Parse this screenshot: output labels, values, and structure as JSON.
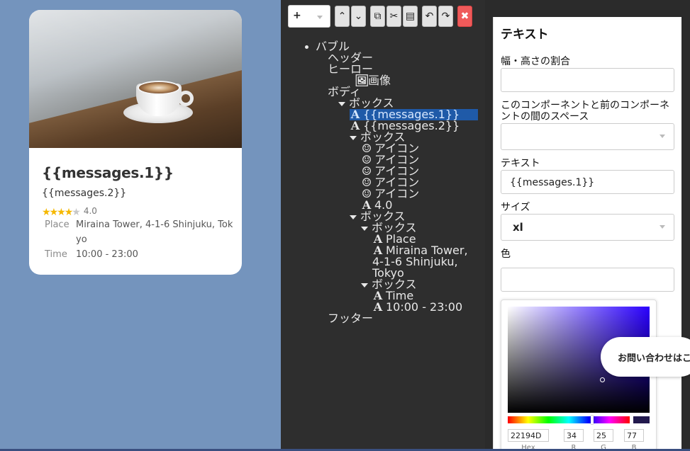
{
  "preview": {
    "title": "{{messages.1}}",
    "subtitle": "{{messages.2}}",
    "rating": {
      "value": 4,
      "max": 5,
      "label": "4.0"
    },
    "rows": [
      {
        "label": "Place",
        "value": "Miraina Tower, 4-1-6 Shinjuku, Tokyo"
      },
      {
        "label": "Time",
        "value": "10:00 - 23:00"
      }
    ]
  },
  "toolbar": {
    "add_label": "+",
    "up_icon": "chevron-up-icon",
    "down_icon": "chevron-down-icon",
    "copy_icon": "copy-icon",
    "cut_icon": "scissors-icon",
    "paste_icon": "paste-icon",
    "undo_icon": "undo-icon",
    "redo_icon": "redo-icon",
    "delete_icon": "close-icon",
    "up_glyph": "⌃",
    "down_glyph": "⌄",
    "copy_glyph": "⧉",
    "cut_glyph": "✂",
    "paste_glyph": "▤",
    "undo_glyph": "↶",
    "redo_glyph": "↷",
    "delete_glyph": "✖"
  },
  "tree": {
    "bubble": "バブル",
    "header": "ヘッダー",
    "hero": "ヒーロー",
    "image": "画像",
    "body": "ボディ",
    "box1": "ボックス",
    "text_msg1": "{{messages.1}}",
    "text_msg2": "{{messages.2}}",
    "box2": "ボックス",
    "icons": [
      "アイコン",
      "アイコン",
      "アイコン",
      "アイコン",
      "アイコン"
    ],
    "rating_text": "4.0",
    "box3": "ボックス",
    "box3a": "ボックス",
    "place": "Place",
    "address": "Miraina Tower, 4-1-6 Shinjuku, Tokyo",
    "box3b": "ボックス",
    "time": "Time",
    "hours": "10:00 - 23:00",
    "footer": "フッター",
    "text_glyph": "A",
    "image_glyph": "🖼",
    "icon_glyph": "☺"
  },
  "props": {
    "title": "テキスト",
    "flex_label": "幅・高さの割合",
    "flex_value": "",
    "margin_label": "このコンポーネントと前のコンポーネントの間のスペース",
    "margin_value": "",
    "text_label": "テキスト",
    "text_value": "{{messages.1}}",
    "size_label": "サイズ",
    "size_value": "xl",
    "color_label": "色",
    "color_value": "",
    "picker": {
      "hex": "22194D",
      "r": "34",
      "g": "25",
      "b": "77",
      "hex_label": "Hex",
      "r_label": "R",
      "g_label": "G",
      "b_label": "B",
      "swatch_color": "#22194d"
    }
  },
  "chat_bubble": {
    "text": "お問い合わせはこちら"
  }
}
